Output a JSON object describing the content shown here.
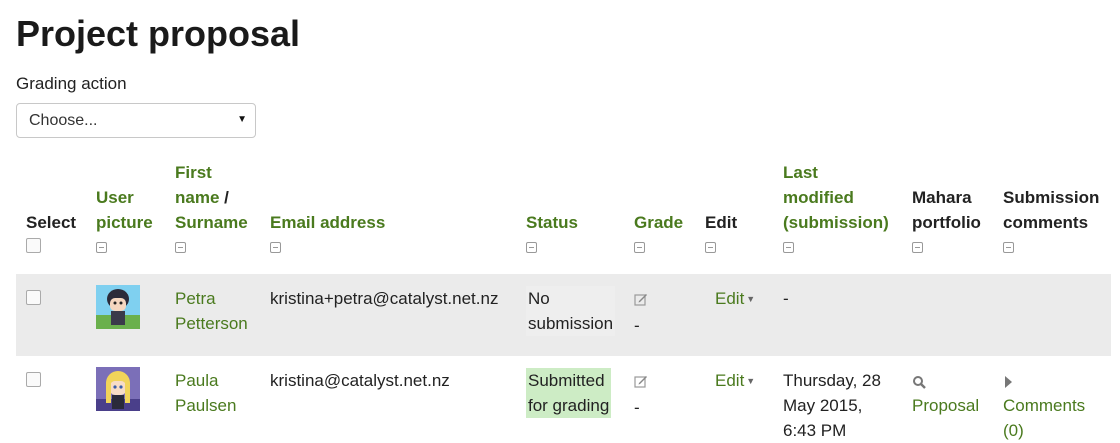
{
  "page": {
    "title": "Project proposal",
    "grading_action_label": "Grading action",
    "grading_action_value": "Choose..."
  },
  "table": {
    "headers": {
      "select": "Select",
      "user_picture_1": "User",
      "user_picture_2": "picture",
      "first_name": "First",
      "name_sep1": "name",
      "name_sep2": " /",
      "surname": "Surname",
      "email": "Email address",
      "status": "Status",
      "grade": "Grade",
      "edit": "Edit",
      "last_modified_1": "Last",
      "last_modified_2": "modified",
      "last_modified_3": "(submission)",
      "mahara_1": "Mahara",
      "mahara_2": "portfolio",
      "submission_comments_1": "Submission",
      "submission_comments_2": "comments"
    },
    "rows": [
      {
        "first_name": "Petra",
        "surname": "Petterson",
        "email": "kristina+petra@catalyst.net.nz",
        "status_1": "No",
        "status_2": "submission",
        "grade": "-",
        "edit": "Edit",
        "last_modified": "-",
        "portfolio": "",
        "comments": ""
      },
      {
        "first_name": "Paula",
        "surname": "Paulsen",
        "email": "kristina@catalyst.net.nz",
        "status_1": "Submitted",
        "status_2": "for grading",
        "grade": "-",
        "edit": "Edit",
        "last_modified_1": "Thursday, 28",
        "last_modified_2": "May 2015,",
        "last_modified_3": "6:43 PM",
        "portfolio": "Proposal",
        "comments_1": "Comments",
        "comments_2": "(0)"
      }
    ]
  },
  "colors": {
    "link": "#4a7a1e",
    "row_shade": "#ebebeb",
    "submitted_bg": "#cdecc5"
  },
  "icons": [
    "collapse-column-icon",
    "edit-pen-icon",
    "magnifier-icon",
    "expand-triangle-icon",
    "caret-down-icon"
  ]
}
